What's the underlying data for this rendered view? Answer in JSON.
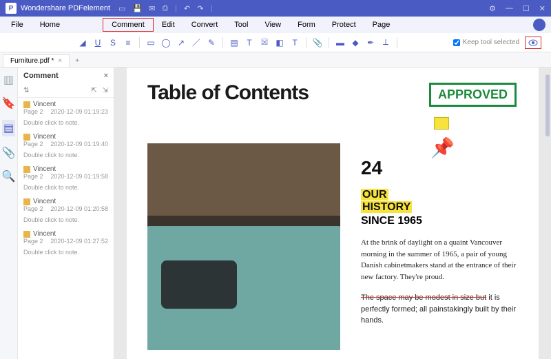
{
  "titlebar": {
    "app_name": "Wondershare PDFelement"
  },
  "menu": {
    "items": [
      "File",
      "Home",
      "Comment",
      "Edit",
      "Convert",
      "Tool",
      "View",
      "Form",
      "Protect",
      "Page"
    ],
    "active_index": 2
  },
  "toolbar": {
    "keep_label": "Keep tool selected"
  },
  "tab": {
    "name": "Furniture.pdf *"
  },
  "sidebar": {
    "title": "Comment",
    "entries": [
      {
        "user": "Vincent",
        "page": "Page 2",
        "time": "2020-12-09 01:19:23",
        "note": "Double click to note."
      },
      {
        "user": "Vincent",
        "page": "Page 2",
        "time": "2020-12-09 01:19:40",
        "note": "Double click to note."
      },
      {
        "user": "Vincent",
        "page": "Page 2",
        "time": "2020-12-09 01:19:58",
        "note": "Double click to note."
      },
      {
        "user": "Vincent",
        "page": "Page 2",
        "time": "2020-12-09 01:20:58",
        "note": "Double click to note."
      },
      {
        "user": "Vincent",
        "page": "Page 2",
        "time": "2020-12-09 01:27:52",
        "note": "Double click to note."
      }
    ]
  },
  "doc": {
    "title": "Table of Contents",
    "stamp": "APPROVED",
    "number": "24",
    "highlight1": "OUR",
    "highlight2": "HISTORY",
    "since": "SINCE 1965",
    "para1": "At the brink of daylight on a quaint Vancouver morning in the summer of 1965, a pair of young Danish cabinetmakers stand at the entrance of their new factory. They're proud.",
    "strike": "The space may be modest in size but",
    "para2_rest": " it is perfectly formed; all painstakingly built by their hands."
  }
}
